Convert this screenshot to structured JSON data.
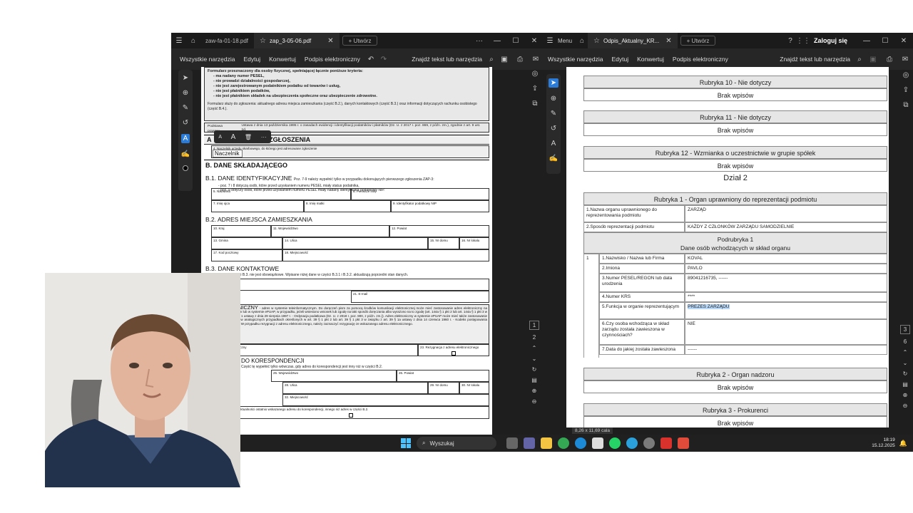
{
  "left_window": {
    "tabs": [
      {
        "label": "zaw-fa-01-18.pdf"
      },
      {
        "label": "zap_3-05-06.pdf"
      },
      {
        "label": "+ Utwórz"
      }
    ],
    "toolbar": {
      "all_tools": "Wszystkie narzędzia",
      "edit": "Edytuj",
      "convert": "Konwertuj",
      "sign": "Podpis elektroniczny",
      "find": "Znajdź tekst lub narzędzia"
    },
    "doc": {
      "intro_title": "Formularz przeznaczony dla osoby fizycznej, spełniającej łącznie poniższe kryteria:",
      "criteria": [
        "- ma nadany numer PESEL,",
        "- nie prowadzi działalności gospodarczej,",
        "- nie jest zarejestrowanym podatnikiem podatku od towarów i usług,",
        "- nie jest płatnikiem podatków,",
        "- nie jest płatnikiem składek na ubezpieczenia społeczne oraz ubezpieczenie zdrowotne."
      ],
      "purpose": "Formularz służy do zgłoszenia: aktualnego adresu miejsca zamieszkania (część B.2.), danych kontaktowych (część B.3.) oraz informacji dotyczących rachunku osobistego (część B.4.).",
      "legal_label": "Podstawa prawna:",
      "legal_text": "Ustawa z dnia 13 października 1995 r. o zasadach ewidencji i identyfikacji podatników i płatników (Dz. U. z 2017 r. poz. 869, z późn. zm.), zgodnie z art. 9 ust. 1d.",
      "section_a": "A. MIEJSCE I CEL SKŁADANIA ZGŁOSZENIA",
      "section_a_visible": "A",
      "section_a_tail": "IA ZGŁOSZENIA",
      "field4_label": "4. Naczelnik urzędu skarbowego, do którego jest adresowane zgłoszenie",
      "field4_value": "Naczelnik",
      "section_b": "B. DANE SKŁADAJĄCEGO",
      "b1_title": "B.1. DANE IDENTYFIKACYJNE",
      "b1_note": "Poz. 7-9 należy wypełnić tylko w przypadku dokonujących pierwszego zgłoszenia ZAP-3:",
      "b1_note2": "- poz. 7 i 8 dotyczą osób, które przed uzyskaniem numeru PESEL miały status podatnika,",
      "b1_note3": "- poz. 9 dotyczy osób, które przed uzyskaniem numeru PESEL miały nadany identyfikator podatkowy NIP.",
      "f5": "5. Nazwisko",
      "f6": "6. Pierwsze imię",
      "f7": "7. Imię ojca",
      "f8": "8. Imię matki",
      "f9": "9. Identyfikator podatkowy NIP",
      "b2_title": "B.2. ADRES MIEJSCA ZAMIESZKANIA",
      "f10": "10. Kraj",
      "f11": "11. Województwo",
      "f12": "12. Powiat",
      "f13": "13. Gmina",
      "f14": "14. Ulica",
      "f15": "15. Nr domu",
      "f16": "16. Nr lokalu",
      "f17": "17. Kod pocztowy",
      "f18": "18. Miejscowość",
      "b3_title": "B.3. DANE KONTAKTOWE",
      "b3_note": "Wypełnienie części B.3. nie jest obowiązkowe. Wpisane niżej dane w części B.3.1 i B.3.2. aktualizują poprzedni stan danych.",
      "f21": "21. E-mail",
      "epuap_title": "ELEKTRONICZNY",
      "epuap_text": "- adres w systemie teleinformatycznym. Do doręczeń pism za pomocą środków komunikacji elektronicznej może mieć zastosowanie adres elektroniczny na portalu podatkowym lub w systemie ePUAP, w przypadku, jeżeli wniesiono wniosek lub zgodę na taki sposób doręczania albo wyrażono na to zgodę (art. 144a § 1 pkt 2 lub art. 144a § 1 pkt 3 w związku z art. 3e § 1 ustawy z dnia 29 sierpnia 1997 r. - Ordynacja podatkowa (Dz. U. z 2018 r. poz. 800, z późn. zm.)). Adres elektroniczny w systemie ePUAP może mieć także zastosowanie do doręczeń pism w analogicznych przypadkach określonych w art. 39 § 1 pkt 2 lub art. 39 § 1 pkt 3 w związku z art. 39 § 1a ustawy z dnia 14 czerwca 1960 r. - Kodeks postępowania administracyjnego. W przypadku rezygnacji z adresu elektronicznego, należy zaznaczyć rezygnację ze wskazanego adresu elektronicznego.",
      "f22": "22. Adres elektroniczny",
      "f23": "23. Rezygnacja z adresu elektronicznego",
      "koresp_title": "DO KORESPONDENCJI",
      "koresp_note": "Część tę wypełnić tylko wówczas, gdy adres do korespondencji jest inny niż w części B.2.",
      "f25": "25. Województwo",
      "f26": "26. Powiat",
      "f28": "28. Ulica",
      "f29": "29. Nr domu",
      "f30": "30. Nr lokalu",
      "f32": "32. Miejscowość",
      "f33": "33. Rezygnacja z aktualności ostatnio wskazanego adresu do korespondencji, innego niż adres w części B.2."
    },
    "mini_toolbar": {
      "a_small": "A",
      "a_large": "A",
      "more": "···"
    },
    "page_numbers": [
      "1",
      "2"
    ]
  },
  "right_window": {
    "menu": "Menu",
    "tab": "Odpis_Aktualny_KR...",
    "new_tab": "+ Utwórz",
    "login": "Zaloguj się",
    "toolbar": {
      "all_tools": "Wszystkie narzędzia",
      "edit": "Edytuj",
      "convert": "Konwertuj",
      "sign": "Podpis elektroniczny",
      "find": "Znajdź tekst lub narzędzia"
    },
    "doc": {
      "r10_head": "Rubryka 10 - Nie dotyczy",
      "r10_val": "Brak wpisów",
      "r11_head": "Rubryka 11 - Nie dotyczy",
      "r11_val": "Brak wpisów",
      "r12_head": "Rubryka 12 - Wzmianka o uczestnictwie w grupie spółek",
      "r12_val": "Brak wpisów",
      "dzial": "Dział 2",
      "r1_head": "Rubryka 1 - Organ uprawniony do reprezentacji podmiotu",
      "r1_rows": [
        {
          "label": "1.Nazwa organu uprawnionego do reprezentowania podmiotu",
          "value": "ZARZĄD"
        },
        {
          "label": "2.Sposób reprezentacji podmiotu",
          "value": "KAŻDY Z CZŁONKÓW ZARZĄDU SAMODZIELNIE"
        }
      ],
      "podrubryka": "Podrubryka 1",
      "podrubryka_sub": "Dane osób wchodzących w skład organu",
      "entry_no": "1",
      "members": [
        {
          "label": "1.Nazwisko / Nazwa lub Firma",
          "value": "KOVAL"
        },
        {
          "label": "2.Imiona",
          "value": "PAVLO"
        },
        {
          "label": "3.Numer PESEL/REGON lub data urodzenia",
          "value": "89041216735, ------"
        },
        {
          "label": "4.Numer KRS",
          "value": "****"
        },
        {
          "label": "5.Funkcja w organie reprezentującym",
          "value": "PREZES ZARZĄDU"
        },
        {
          "label": "6.Czy osoba wchodząca w skład zarządu została zawieszona w czynnościach?",
          "value": "NIE"
        },
        {
          "label": "7.Data do jakiej została zawieszona",
          "value": "------"
        }
      ],
      "r2_head": "Rubryka 2 - Organ nadzoru",
      "r2_val": "Brak wpisów",
      "r3_head": "Rubryka 3 - Prokurenci",
      "r3_val": "Brak wpisów"
    },
    "page_size": "8,26 x 11,69 cala",
    "page_numbers": [
      "3",
      "6"
    ]
  },
  "taskbar": {
    "search": "Wyszukaj",
    "time": "18:19",
    "date": "15.12.2025"
  },
  "colors": {
    "accent_blue": "#2b7bd9",
    "highlight": "#b6d7f7",
    "adobe_red": "#d9312b"
  }
}
